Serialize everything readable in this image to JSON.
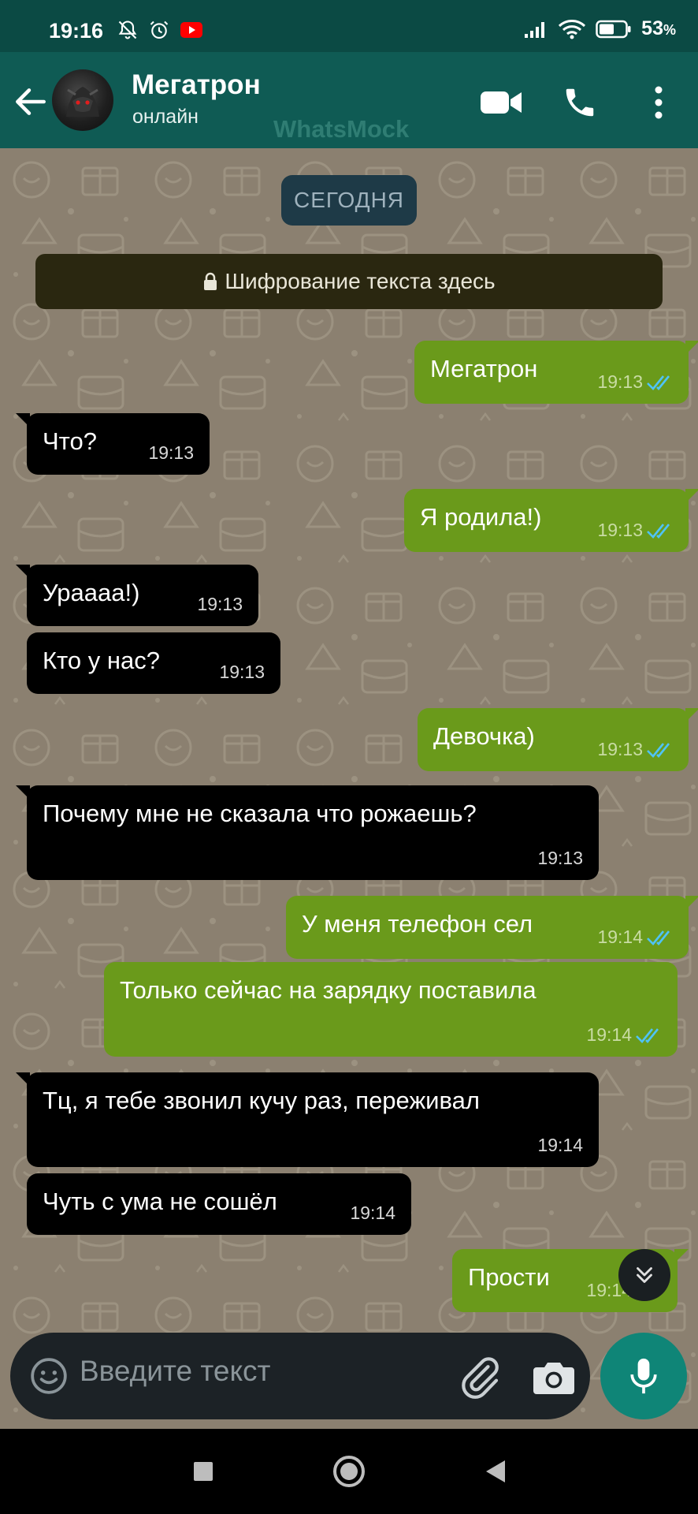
{
  "status_bar": {
    "time": "19:16",
    "battery": "53",
    "battery_unit": "%"
  },
  "header": {
    "contact_name": "Мегатрон",
    "contact_status": "онлайн",
    "watermark": "WhatsMock"
  },
  "chat": {
    "date_label": "СЕГОДНЯ",
    "encryption_notice": "Шифрование текста здесь",
    "messages": [
      {
        "dir": "out",
        "text": "Мегатрон",
        "time": "19:13"
      },
      {
        "dir": "in",
        "text": "Что?",
        "time": "19:13"
      },
      {
        "dir": "out",
        "text": "Я родила!)",
        "time": "19:13"
      },
      {
        "dir": "in",
        "text": "Ураааа!)",
        "time": "19:13"
      },
      {
        "dir": "in",
        "text": "Кто у нас?",
        "time": "19:13"
      },
      {
        "dir": "out",
        "text": "Девочка)",
        "time": "19:13"
      },
      {
        "dir": "in",
        "text": "Почему мне не сказала что рожаешь?",
        "time": "19:13"
      },
      {
        "dir": "out",
        "text": "У меня телефон сел",
        "time": "19:14"
      },
      {
        "dir": "out",
        "text": "Только сейчас на зарядку поставила",
        "time": "19:14"
      },
      {
        "dir": "in",
        "text": "Тц, я тебе звонил кучу раз, переживал",
        "time": "19:14"
      },
      {
        "dir": "in",
        "text": "Чуть с ума не сошёл",
        "time": "19:14"
      },
      {
        "dir": "out",
        "text": "Прости",
        "time": "19:14"
      }
    ]
  },
  "input": {
    "placeholder": "Введите текст"
  },
  "colors": {
    "header": "#0f5b54",
    "outgoing_bubble": "#6a9a1b",
    "incoming_bubble": "#000000",
    "chat_background": "#8b8070",
    "read_tick": "#4fc3f7",
    "mic_button": "#0f8577"
  },
  "icons": {
    "back": "arrow-left-icon",
    "video_call": "video-camera-icon",
    "voice_call": "phone-icon",
    "menu": "more-vert-icon",
    "emoji": "smile-icon",
    "attach": "paperclip-icon",
    "camera": "camera-icon",
    "mic": "mic-icon",
    "scroll_down": "double-chevron-down-icon"
  }
}
